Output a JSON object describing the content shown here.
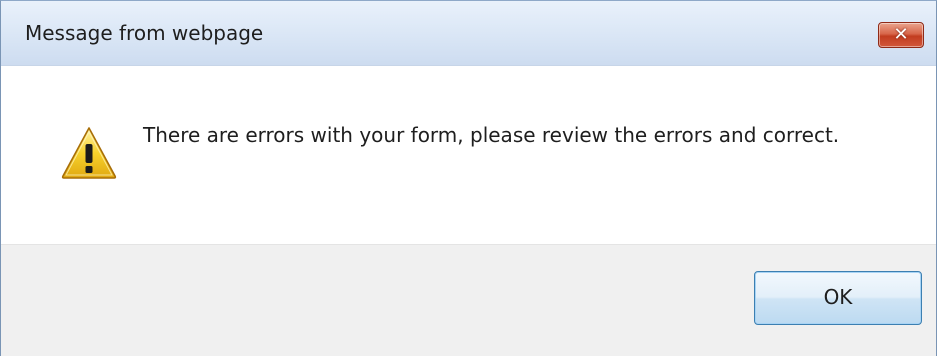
{
  "dialog": {
    "title": "Message from webpage",
    "close_button": {
      "icon": "close-icon",
      "glyph": "✕",
      "color": "#c94a2c"
    },
    "icon": "warning-icon",
    "message": "There are errors with your form, please review the errors and correct.",
    "ok_button_label": "OK"
  },
  "colors": {
    "titlebar": "#dbe7f6",
    "footer": "#f0f0f0",
    "button_border": "#3c7fb1",
    "warning_yellow": "#f7d22c"
  }
}
